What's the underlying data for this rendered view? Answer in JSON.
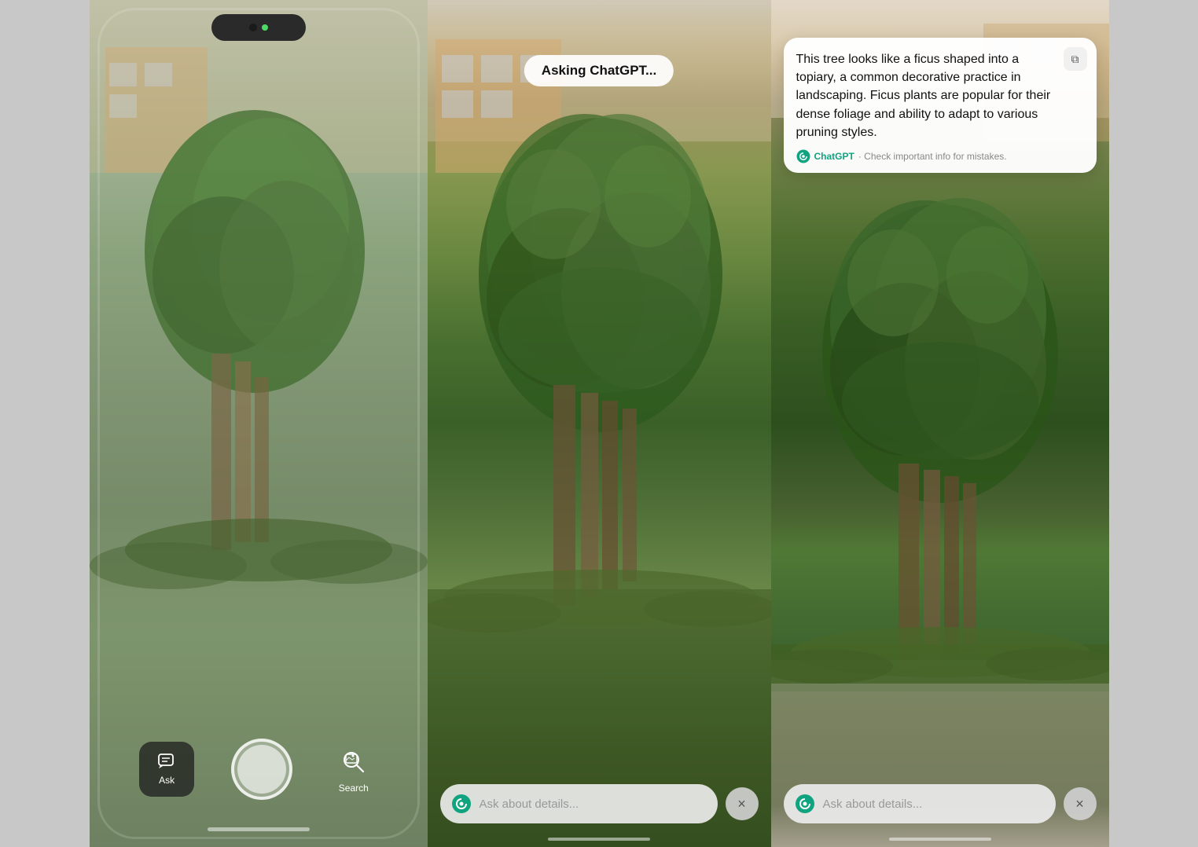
{
  "phone1": {
    "notch_label": "camera notch",
    "ask_label": "Ask",
    "search_label": "Search",
    "bottom_bar": ""
  },
  "phone2": {
    "asking_text": "Asking ChatGPT...",
    "input_placeholder": "Ask about details...",
    "close_icon": "×"
  },
  "phone3": {
    "response_text": "This tree looks like a ficus shaped into a topiary, a common decorative practice in landscaping. Ficus plants are popular for their dense foliage and ability to adapt to various pruning styles.",
    "chatgpt_label": "ChatGPT",
    "disclaimer": "· Check important info for mistakes.",
    "input_placeholder": "Ask about details...",
    "close_icon": "×",
    "copy_icon": "⧉"
  }
}
